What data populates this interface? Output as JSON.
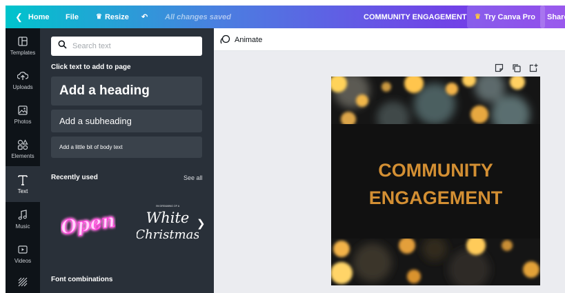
{
  "topbar": {
    "home_label": "Home",
    "file_label": "File",
    "resize_label": "Resize",
    "undo_icon": "undo-icon",
    "saved_status": "All changes saved",
    "document_title": "COMMUNITY ENGAGEMENT",
    "pro_label": "Try Canva Pro",
    "share_label": "Share"
  },
  "rail": {
    "items": [
      {
        "label": "Templates",
        "icon": "templates-icon"
      },
      {
        "label": "Uploads",
        "icon": "upload-icon"
      },
      {
        "label": "Photos",
        "icon": "photos-icon"
      },
      {
        "label": "Elements",
        "icon": "elements-icon"
      },
      {
        "label": "Text",
        "icon": "text-icon"
      },
      {
        "label": "Music",
        "icon": "music-icon"
      },
      {
        "label": "Videos",
        "icon": "videos-icon"
      },
      {
        "label": "",
        "icon": "background-icon"
      }
    ],
    "active": "Text"
  },
  "panel": {
    "search_placeholder": "Search text",
    "click_hint": "Click text to add to page",
    "add_heading": "Add a heading",
    "add_subheading": "Add a subheading",
    "add_body": "Add a little bit of body text",
    "recently_used": "Recently used",
    "see_all": "See all",
    "recent": [
      {
        "text": "Open",
        "style": "neon",
        "color": "#ff3bd9"
      },
      {
        "small_text": "I'M DREAMING OF A",
        "line1": "White",
        "line2": "Christmas",
        "style": "script"
      }
    ],
    "font_combinations": "Font combinations"
  },
  "editor": {
    "animate_label": "Animate",
    "page_tools": [
      "notes-icon",
      "duplicate-page-icon",
      "add-page-icon"
    ]
  },
  "design": {
    "line1": "COMMUNITY",
    "line2": "ENGAGEMENT",
    "text_color": "#d38f33",
    "band_color": "#111111"
  },
  "colors": {
    "rail_bg": "#0e1318",
    "panel_bg": "#293039",
    "button_bg": "#3a424b",
    "workspace_bg": "#ebecf0",
    "topbar_gradient_start": "#00c4cc",
    "topbar_gradient_end": "#7d2ae8"
  }
}
